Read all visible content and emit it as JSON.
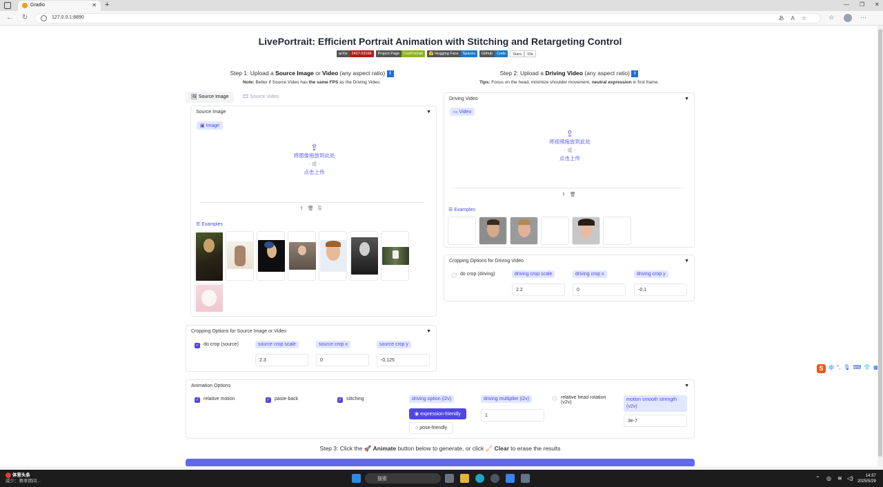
{
  "browser": {
    "tab_title": "Gradio",
    "url": "127.0.0.1:8890",
    "window_controls": [
      "—",
      "❐",
      "✕"
    ]
  },
  "page": {
    "title": "LivePortrait: Efficient Portrait Animation with Stitching and Retargeting Control",
    "badges": [
      {
        "left": "arXiv",
        "right": "2407.03168",
        "right_color": "#b31b1b"
      },
      {
        "left": "Project Page",
        "right": "LivePortrait",
        "right_color": "#8fb31b"
      },
      {
        "left": "🤗 Hugging Face",
        "right": "Spaces",
        "right_color": "#1e78c8"
      },
      {
        "left": "Github",
        "right": "Code",
        "right_color": "#1e78c8"
      },
      {
        "left": "Stars",
        "right": "15k",
        "right_color": "#ffffff"
      }
    ]
  },
  "step1": {
    "prefix": "Step 1: Upload a ",
    "source_image": "Source Image",
    "or": " or ",
    "video": "Video",
    "suffix": " (any aspect ratio) ",
    "info": "i",
    "note_prefix": "Note:",
    "note_text": " Better if Source Video has ",
    "note_bold": "the same FPS",
    "note_tail": " as the Driving Video."
  },
  "step2": {
    "prefix": "Step 2: Upload a ",
    "driving_video": "Driving Video",
    "suffix": " (any aspect ratio) ",
    "info": "i",
    "tips_prefix": "Tips:",
    "tips_text": " Focus on the head, minimize shoulder movement, ",
    "tips_bold": "neutral expression",
    "tips_tail": " in first frame."
  },
  "source_tabs": [
    "Source Image",
    "Source Video"
  ],
  "source_panel": {
    "header": "Source Image",
    "block_label": "Image",
    "upload_line1": "将图像拖放到此处",
    "upload_line2": "- 或 -",
    "upload_line3": "点击上传",
    "examples_label": "Examples"
  },
  "driving_panel": {
    "header": "Driving Video",
    "block_label": "Video",
    "upload_line1": "将视频拖放到此处",
    "upload_line2": "- 或 -",
    "upload_line3": "点击上传",
    "examples_label": "Examples"
  },
  "driving_crop": {
    "header": "Cropping Options for Driving Video",
    "checkbox": "do crop (driving)",
    "checked": false,
    "fields": [
      {
        "label": "driving crop scale",
        "value": "2.2"
      },
      {
        "label": "driving crop x",
        "value": "0"
      },
      {
        "label": "driving crop y",
        "value": "-0.1"
      }
    ]
  },
  "source_crop": {
    "header": "Cropping Options for Source Image or Video",
    "checkbox": "do crop (source)",
    "checked": true,
    "fields": [
      {
        "label": "source crop scale",
        "value": "2.3"
      },
      {
        "label": "source crop x",
        "value": "0"
      },
      {
        "label": "source crop y",
        "value": "-0.125"
      }
    ]
  },
  "animation": {
    "header": "Animation Options",
    "relative_motion": "relative motion",
    "paste_back": "paste-back",
    "stitching": "stitching",
    "driving_option_label": "driving option (i2v)",
    "option_expression": "expression-friendly",
    "option_pose": "pose-friendly",
    "multiplier_label": "driving multiplier (i2v)",
    "multiplier_value": "1",
    "head_rotation": "relative head rotation (v2v)",
    "smooth_label": "motion smooth strength (v2v)",
    "smooth_value": "3e-7"
  },
  "step3": {
    "prefix": "Step 3: Click the 🚀 ",
    "animate": "Animate",
    "mid": " button below to generate, or click 🧹 ",
    "clear": "Clear",
    "suffix": " to erase the results"
  },
  "ime": {
    "logo": "S",
    "lang": "中"
  },
  "taskbar": {
    "app_name": "体育头条",
    "app_sub": "威少：赛季期间...",
    "search": "搜索",
    "time": "14:37",
    "date": "2025/5/29"
  },
  "colors": {
    "accent": "#4f46e5",
    "accent_light": "#e0e7ff",
    "info_blue": "#1f6fd4"
  }
}
